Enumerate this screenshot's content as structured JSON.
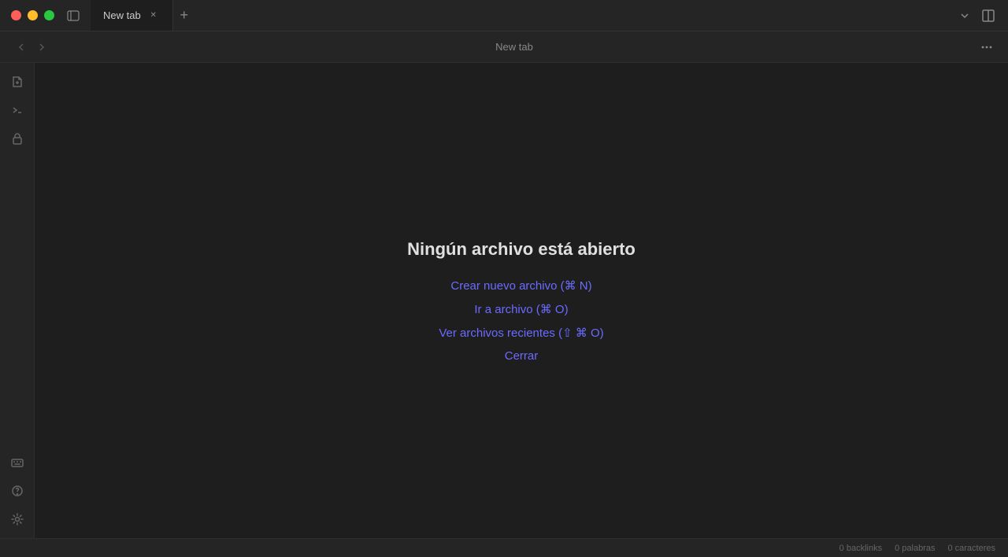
{
  "titleBar": {
    "tabLabel": "New tab",
    "pageTitle": "New tab"
  },
  "toolbar": {
    "title": "New tab",
    "moreLabel": "•••"
  },
  "emptyState": {
    "title": "Ningún archivo está abierto",
    "links": [
      {
        "id": "create-new",
        "label": "Crear nuevo archivo (⌘ N)"
      },
      {
        "id": "go-to-file",
        "label": "Ir a archivo (⌘ O)"
      },
      {
        "id": "recent-files",
        "label": "Ver archivos recientes (⇧ ⌘ O)"
      },
      {
        "id": "close",
        "label": "Cerrar"
      }
    ]
  },
  "statusBar": {
    "backlinks": "0 backlinks",
    "words": "0 palabras",
    "chars": "0 caracteres"
  },
  "sidebar": {
    "topIcons": [
      {
        "id": "new-file",
        "label": "new-file-icon",
        "symbol": "📄"
      },
      {
        "id": "terminal",
        "label": "terminal-icon",
        "symbol": ">_"
      },
      {
        "id": "lock",
        "label": "lock-icon",
        "symbol": "🔒"
      }
    ],
    "bottomIcons": [
      {
        "id": "help-question",
        "label": "help-question-icon",
        "symbol": "?"
      },
      {
        "id": "help-circle",
        "label": "help-circle-icon",
        "symbol": "?"
      },
      {
        "id": "settings",
        "label": "settings-icon",
        "symbol": "⚙"
      }
    ]
  }
}
